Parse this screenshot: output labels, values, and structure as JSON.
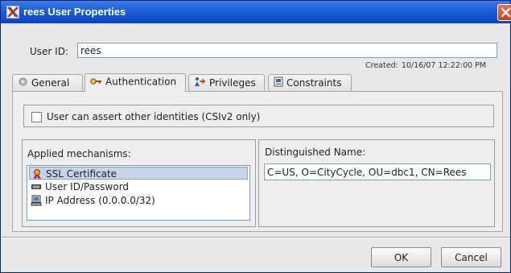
{
  "window": {
    "title": "rees User Properties",
    "app_icon": "x-logo-icon",
    "close_icon": "close-icon"
  },
  "user": {
    "id_label": "User ID:",
    "id_value": "rees",
    "created_label": "Created:",
    "created_value": "10/16/07 12:22:00 PM"
  },
  "tabs": [
    {
      "label": "General",
      "icon": "gear-icon",
      "active": false
    },
    {
      "label": "Authentication",
      "icon": "key-icon",
      "active": true
    },
    {
      "label": "Privileges",
      "icon": "arrow-person-icon",
      "active": false
    },
    {
      "label": "Constraints",
      "icon": "constraint-icon",
      "active": false
    }
  ],
  "authentication": {
    "assert_label": "User can assert other identities (CSIv2 only)",
    "assert_checked": false,
    "mechanisms_title": "Applied mechanisms:",
    "mechanisms": [
      {
        "label": "SSL Certificate",
        "icon": "certificate-icon",
        "selected": true
      },
      {
        "label": "User ID/Password",
        "icon": "keyboard-icon",
        "selected": false
      },
      {
        "label": "IP Address (0.0.0.0/32)",
        "icon": "computer-icon",
        "selected": false
      }
    ],
    "dn_title": "Distinguished Name:",
    "dn_value": "C=US, O=CityCycle, OU=dbc1, CN=Rees"
  },
  "buttons": {
    "ok_label": "OK",
    "cancel_label": "Cancel"
  }
}
